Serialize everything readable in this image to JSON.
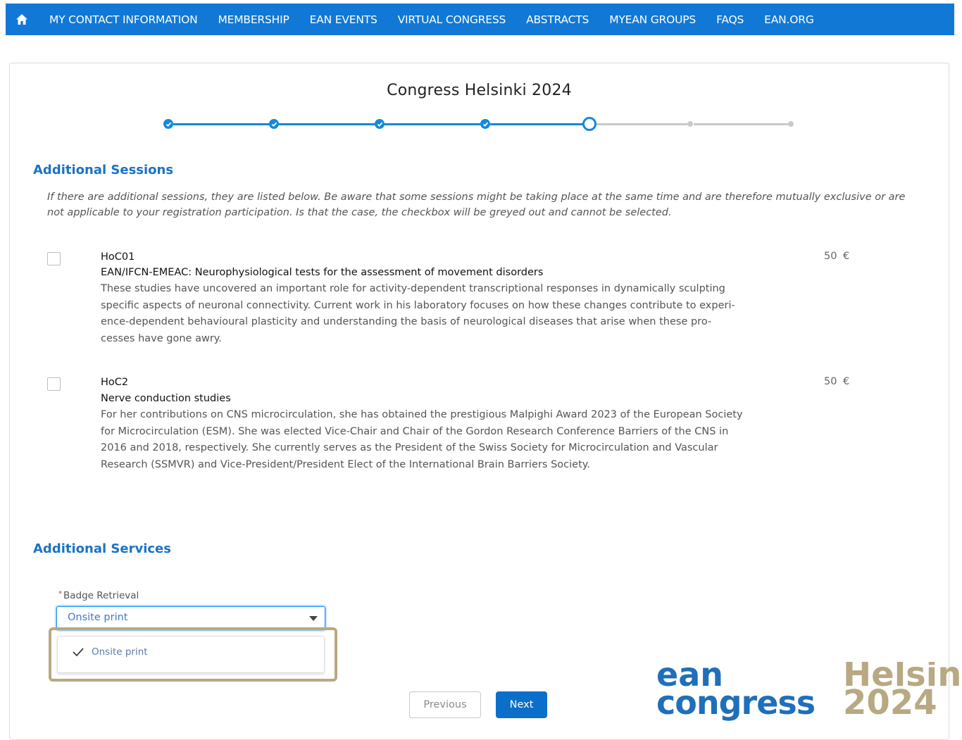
{
  "nav": {
    "items": [
      "MY CONTACT INFORMATION",
      "MEMBERSHIP",
      "EAN EVENTS",
      "VIRTUAL CONGRESS",
      "ABSTRACTS",
      "MYEAN GROUPS",
      "FAQS",
      "EAN.ORG"
    ],
    "icon": "home-icon"
  },
  "page": {
    "title": "Congress Helsinki 2024",
    "progress": {
      "total_steps": 7,
      "completed_steps": 4,
      "current_step": 5
    }
  },
  "additional_sessions": {
    "heading": "Additional Sessions",
    "intro": "If there are additional sessions, they are listed below. Be aware that some sessions might be taking place at the same time and are therefore mutually exclusive or are not applicable to your registration participation. Is that the case, the checkbox will be greyed out and cannot be selected.",
    "sessions": [
      {
        "code": "HoC01",
        "title": "EAN/IFCN-EMEAC: Neurophysiological tests for the assessment of movement disorders",
        "description": "These studies have uncovered an important role for activity-dependent transcriptional responses in dynamically sculpting specific aspects of neuronal connectivity. Current work in his laboratory focuses on how these changes contribute to experi-ence-dependent behavioural plasticity and understanding the basis of neurological diseases that arise when these pro-cesses have gone awry.",
        "price": "50 €",
        "checked": false
      },
      {
        "code": "HoC2",
        "title": "Nerve conduction studies",
        "description": "For her contributions on CNS microcirculation, she has obtained the prestigious Malpighi Award 2023 of the European Society for Microcirculation (ESM). She was elected Vice-Chair and Chair of the Gordon Research Conference Barriers of the CNS in 2016 and 2018, respectively. She currently serves as the President of the Swiss Society for Microcirculation and Vascular Research (SSMVR) and Vice-President/President Elect of the International Brain Barriers Society.",
        "price": "50 €",
        "checked": false
      }
    ]
  },
  "additional_services": {
    "heading": "Additional Services",
    "badge_retrieval": {
      "required_mark": "*",
      "label": "Badge Retrieval",
      "value": "Onsite print",
      "options": [
        "Onsite print"
      ]
    }
  },
  "buttons": {
    "previous": "Previous",
    "next": "Next"
  },
  "logo": {
    "line1": "ean",
    "line2": "congress",
    "city": "Helsinki",
    "year": "2024"
  },
  "colors": {
    "primary": "#1178d6",
    "accent_gold": "#b8a983",
    "heading_blue": "#1a73c4"
  }
}
